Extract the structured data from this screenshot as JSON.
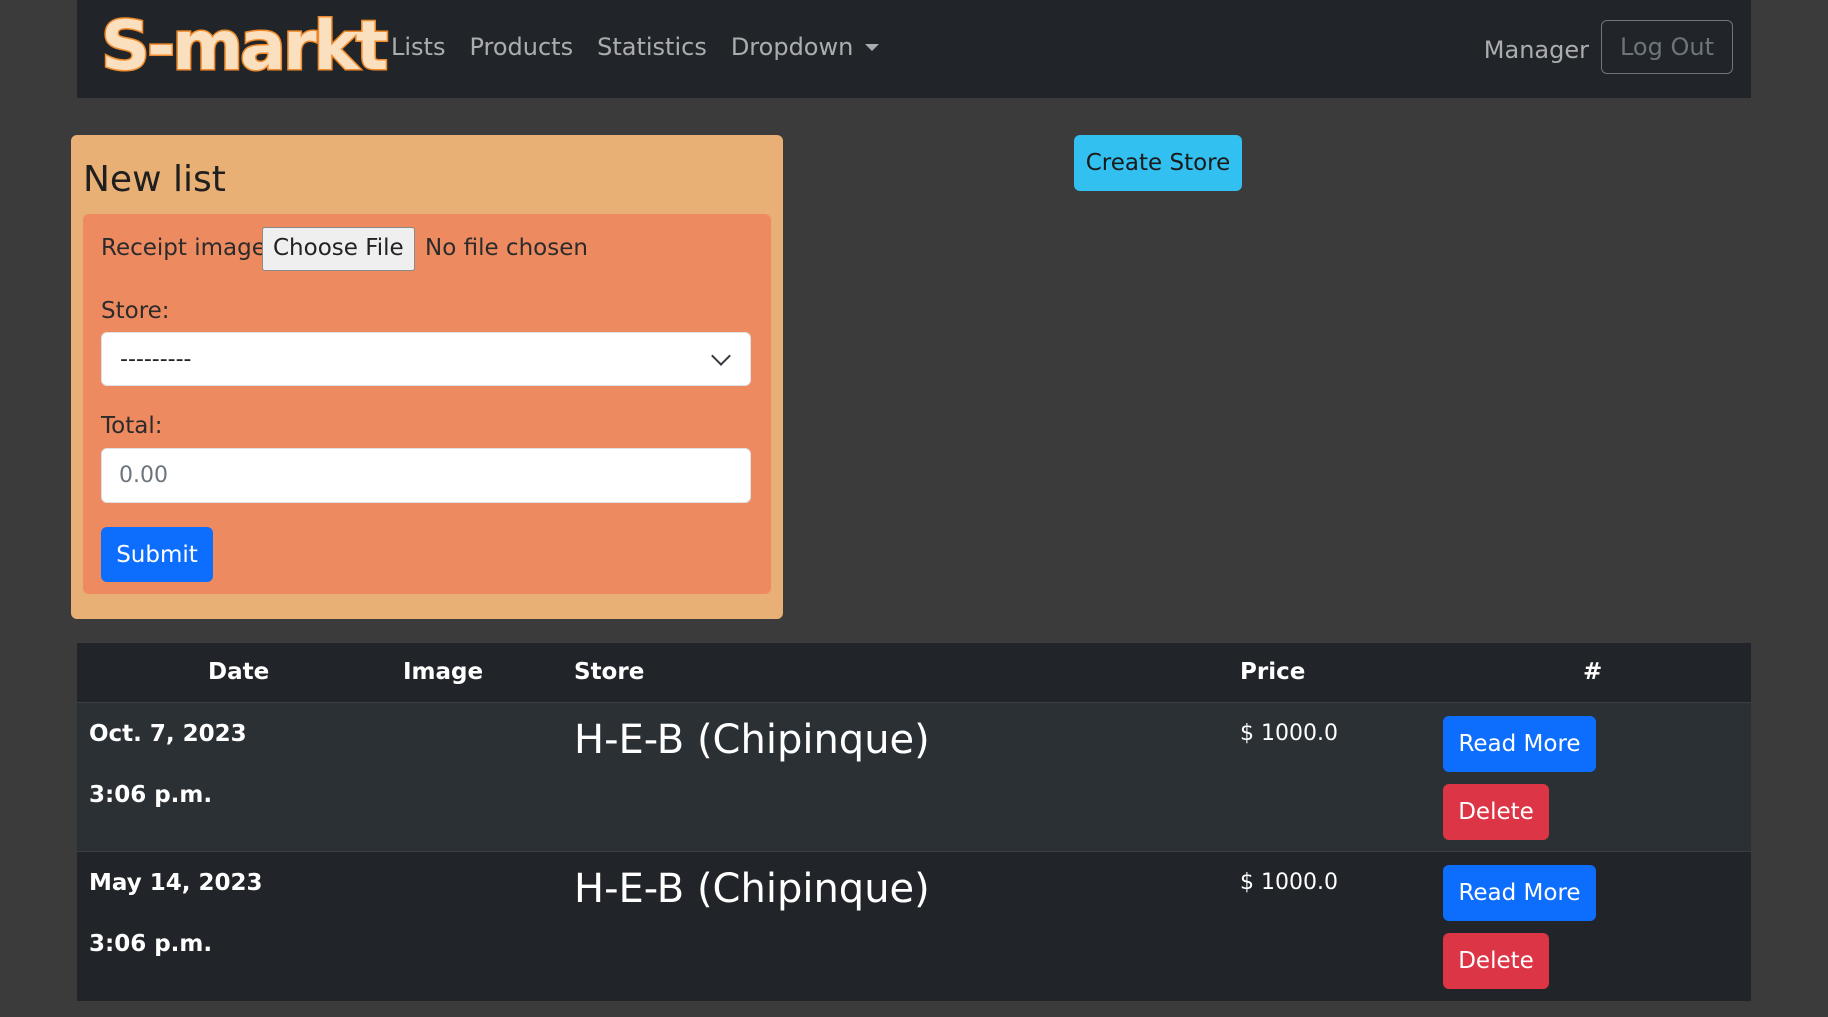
{
  "navbar": {
    "brand": "S-markt",
    "links": [
      "Lists",
      "Products",
      "Statistics"
    ],
    "dropdown_label": "Dropdown",
    "user": "Manager",
    "logout_label": "Log Out"
  },
  "new_list": {
    "title": "New list",
    "receipt_label": "Receipt image:",
    "choose_file_label": "Choose File",
    "file_status": "No file chosen",
    "store_label": "Store:",
    "store_selected": "---------",
    "total_label": "Total:",
    "total_placeholder": "0.00",
    "submit_label": "Submit"
  },
  "create_store_label": "Create Store",
  "table": {
    "headers": [
      "Date",
      "Image",
      "Store",
      "Price",
      "#"
    ],
    "rows": [
      {
        "date": "Oct. 7, 2023",
        "time": "3:06 p.m.",
        "store": "H-E-B (Chipinque)",
        "price": "$ 1000.0",
        "read_more": "Read More",
        "delete": "Delete"
      },
      {
        "date": "May 14, 2023",
        "time": "3:06 p.m.",
        "store": "H-E-B (Chipinque)",
        "price": "$ 1000.0",
        "read_more": "Read More",
        "delete": "Delete"
      }
    ]
  },
  "colors": {
    "navbar_bg": "#212529",
    "page_bg": "#3b3b3b",
    "card_outer": "#e8b074",
    "card_inner": "#ee8a60",
    "primary": "#0d6efd",
    "danger": "#dc3545",
    "info": "#31c0ef"
  }
}
